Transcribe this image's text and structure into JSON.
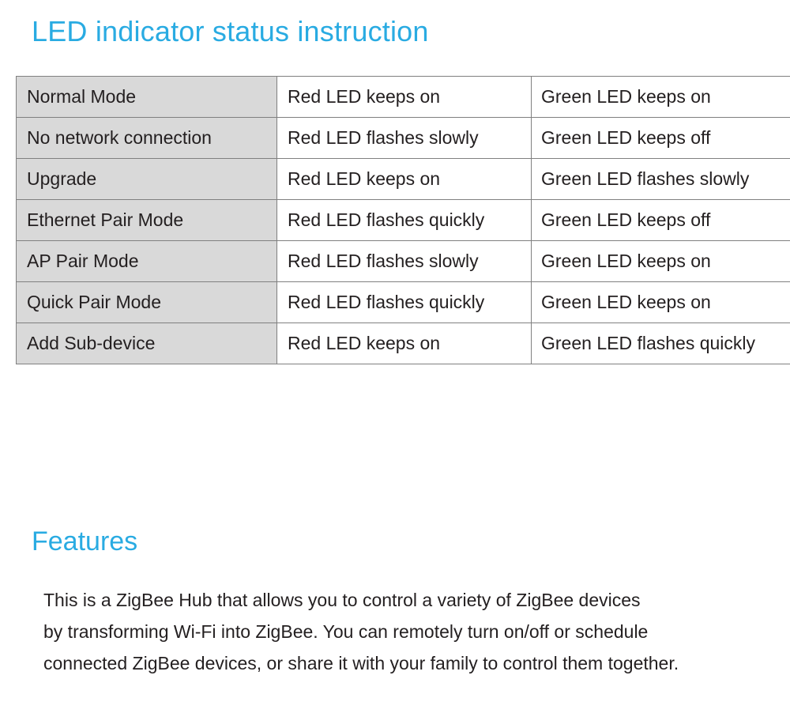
{
  "colors": {
    "heading_blue": "#29abe2",
    "body_text": "#231f20",
    "table_border": "#808080",
    "mode_cell_bg": "#d9d9d9",
    "page_bg": "#ffffff"
  },
  "sections": {
    "led_status": {
      "title": "LED indicator status instruction",
      "table": {
        "rows": [
          {
            "mode": "Normal Mode",
            "red": "Red LED keeps on",
            "green": "Green LED keeps on"
          },
          {
            "mode": "No network connection",
            "red": "Red LED flashes slowly",
            "green": "Green LED keeps off"
          },
          {
            "mode": "Upgrade",
            "red": "Red LED keeps on",
            "green": "Green LED flashes slowly"
          },
          {
            "mode": "Ethernet Pair Mode",
            "red": "Red LED flashes quickly",
            "green": "Green LED keeps off"
          },
          {
            "mode": "AP Pair Mode",
            "red": "Red LED flashes slowly",
            "green": "Green LED keeps on"
          },
          {
            "mode": "Quick Pair Mode",
            "red": "Red LED flashes quickly",
            "green": "Green LED keeps on"
          },
          {
            "mode": "Add Sub-device",
            "red": "Red LED keeps on",
            "green": "Green LED flashes quickly"
          }
        ]
      }
    },
    "features": {
      "title": "Features",
      "paragraph_lines": [
        "This is a ZigBee Hub that allows you to control a variety of ZigBee devices",
        "by transforming Wi-Fi into ZigBee. You can remotely turn on/off or schedule",
        "connected ZigBee devices, or share it with your family to control them together."
      ]
    }
  }
}
